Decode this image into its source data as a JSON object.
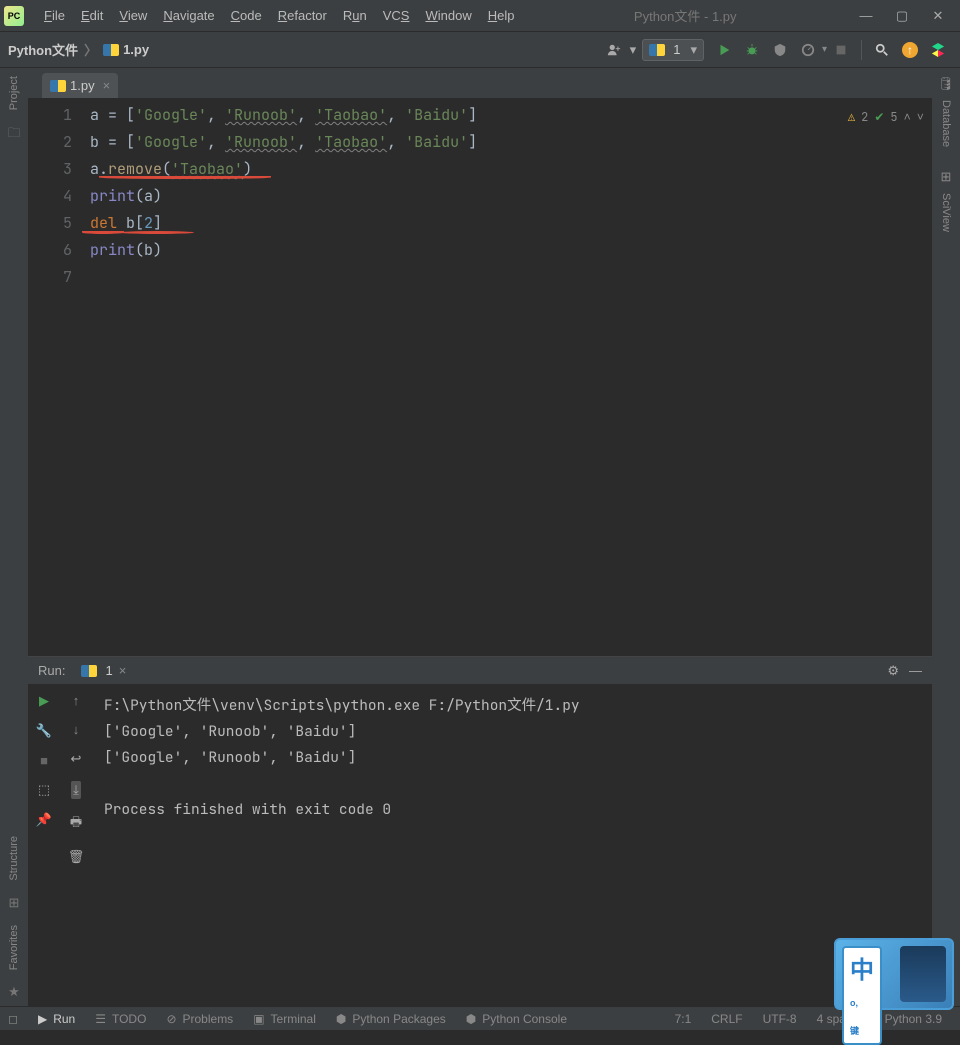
{
  "title": "Python文件 - 1.py",
  "menu": [
    "File",
    "Edit",
    "View",
    "Navigate",
    "Code",
    "Refactor",
    "Run",
    "VCS",
    "Window",
    "Help"
  ],
  "breadcrumb": {
    "root": "Python文件",
    "file": "1.py"
  },
  "run_config": "1",
  "tab": {
    "name": "1.py"
  },
  "line_numbers": [
    "1",
    "2",
    "3",
    "4",
    "5",
    "6",
    "7"
  ],
  "code": {
    "l1_a": "a = [",
    "l1_s1": "'Google'",
    "l1_c1": ", ",
    "l1_s2": "'Runoob'",
    "l1_c2": ", ",
    "l1_s3": "'Taobao'",
    "l1_c3": ", ",
    "l1_s4": "'Baidu'",
    "l1_b": "]",
    "l2_a": "b = [",
    "l2_s1": "'Google'",
    "l2_c1": ", ",
    "l2_s2": "'Runoob'",
    "l2_c2": ", ",
    "l2_s3": "'Taobao'",
    "l2_c3": ", ",
    "l2_s4": "'Baidu'",
    "l2_b": "]",
    "l3_a": "a.",
    "l3_fn": "remove",
    "l3_b": "(",
    "l3_s": "'Taobao'",
    "l3_c": ")",
    "l4_p": "print",
    "l4_b": "(a)",
    "l5_k": "del ",
    "l5_a": "b[",
    "l5_n": "2",
    "l5_b": "]",
    "l6_p": "print",
    "l6_b": "(b)"
  },
  "inspection": {
    "warn": "2",
    "check": "5"
  },
  "run": {
    "title": "Run:",
    "tab": "1",
    "output": "F:\\Python文件\\venv\\Scripts\\python.exe F:/Python文件/1.py\n['Google', 'Runoob', 'Baidu']\n['Google', 'Runoob', 'Baidu']\n\nProcess finished with exit code 0"
  },
  "bottom": {
    "run": "Run",
    "todo": "TODO",
    "problems": "Problems",
    "terminal": "Terminal",
    "packages": "Python Packages",
    "console": "Python Console"
  },
  "status": {
    "pos": "7:1",
    "eol": "CRLF",
    "enc": "UTF-8",
    "indent": "4 spaces",
    "python": "Python 3.9"
  },
  "left_labels": {
    "project": "Project",
    "structure": "Structure",
    "favorites": "Favorites"
  },
  "right_labels": {
    "database": "Database",
    "sciview": "SciView"
  },
  "ime": "中"
}
